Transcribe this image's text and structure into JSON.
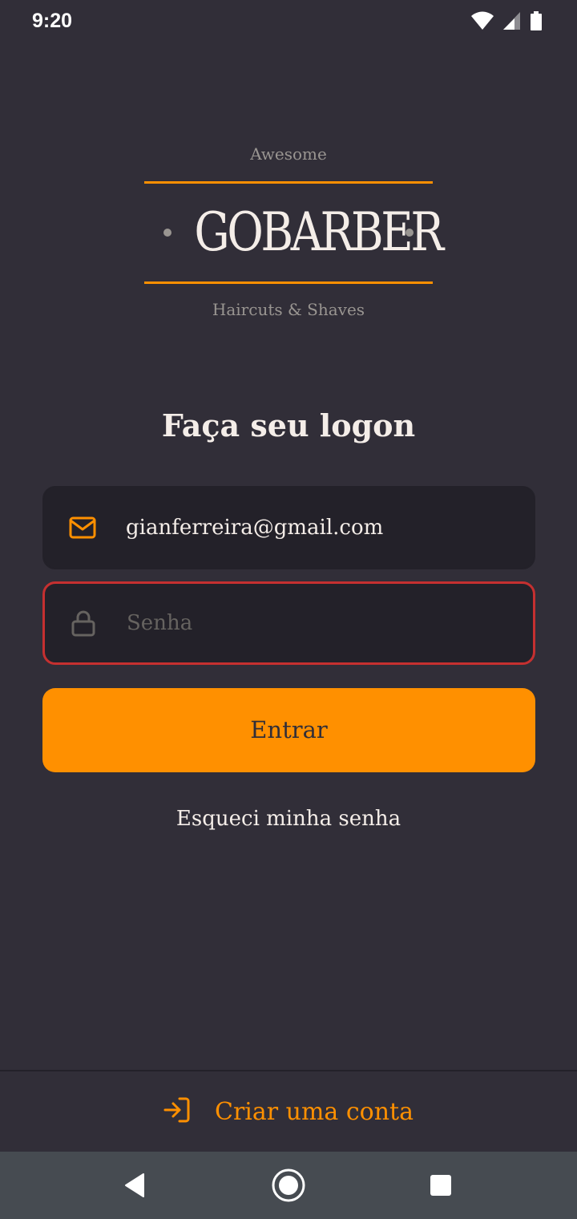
{
  "status_bar": {
    "time": "9:20"
  },
  "logo": {
    "top_text": "Awesome",
    "title": "GOBARBER",
    "bottom_text": "Haircuts & Shaves"
  },
  "login": {
    "title": "Faça seu logon",
    "email": {
      "value": "gianferreira@gmail.com",
      "icon": "mail-icon"
    },
    "password": {
      "placeholder": "Senha",
      "value": "",
      "icon": "lock-icon",
      "state": "error"
    },
    "submit_label": "Entrar",
    "forgot_label": "Esqueci minha senha"
  },
  "footer": {
    "create_account_label": "Criar uma conta",
    "icon": "log-in-icon"
  },
  "colors": {
    "background": "#312e38",
    "input_background": "#232129",
    "accent": "#ff9000",
    "error": "#c53030",
    "text": "#f4ede8",
    "muted": "#999591",
    "placeholder": "#666360",
    "nav_bar": "#464b51"
  }
}
